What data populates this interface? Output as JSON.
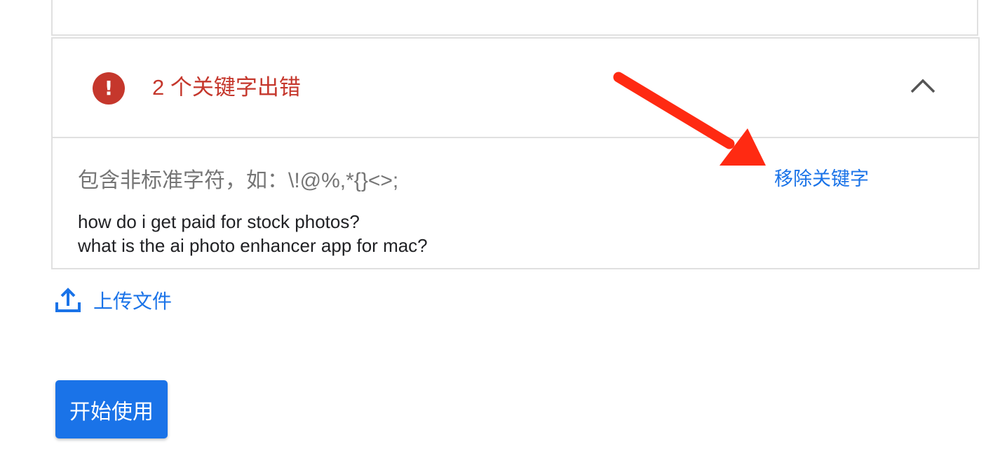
{
  "error_panel": {
    "icon": "error-exclamation-icon",
    "icon_glyph": "!",
    "title": "2 个关键字出错",
    "collapse_icon": "chevron-up-icon",
    "description": "包含非标准字符，如：\\!@%,*{}<>;",
    "remove_label": "移除关键字",
    "keywords": [
      "how do i get paid for stock photos?",
      "what is the ai photo enhancer app for mac?"
    ]
  },
  "upload": {
    "icon": "upload-icon",
    "label": "上传文件"
  },
  "start_button": {
    "label": "开始使用"
  },
  "colors": {
    "error": "#c5372c",
    "accent": "#1a73e8",
    "annotation": "#ff2a12",
    "border": "#e0e0e0"
  }
}
